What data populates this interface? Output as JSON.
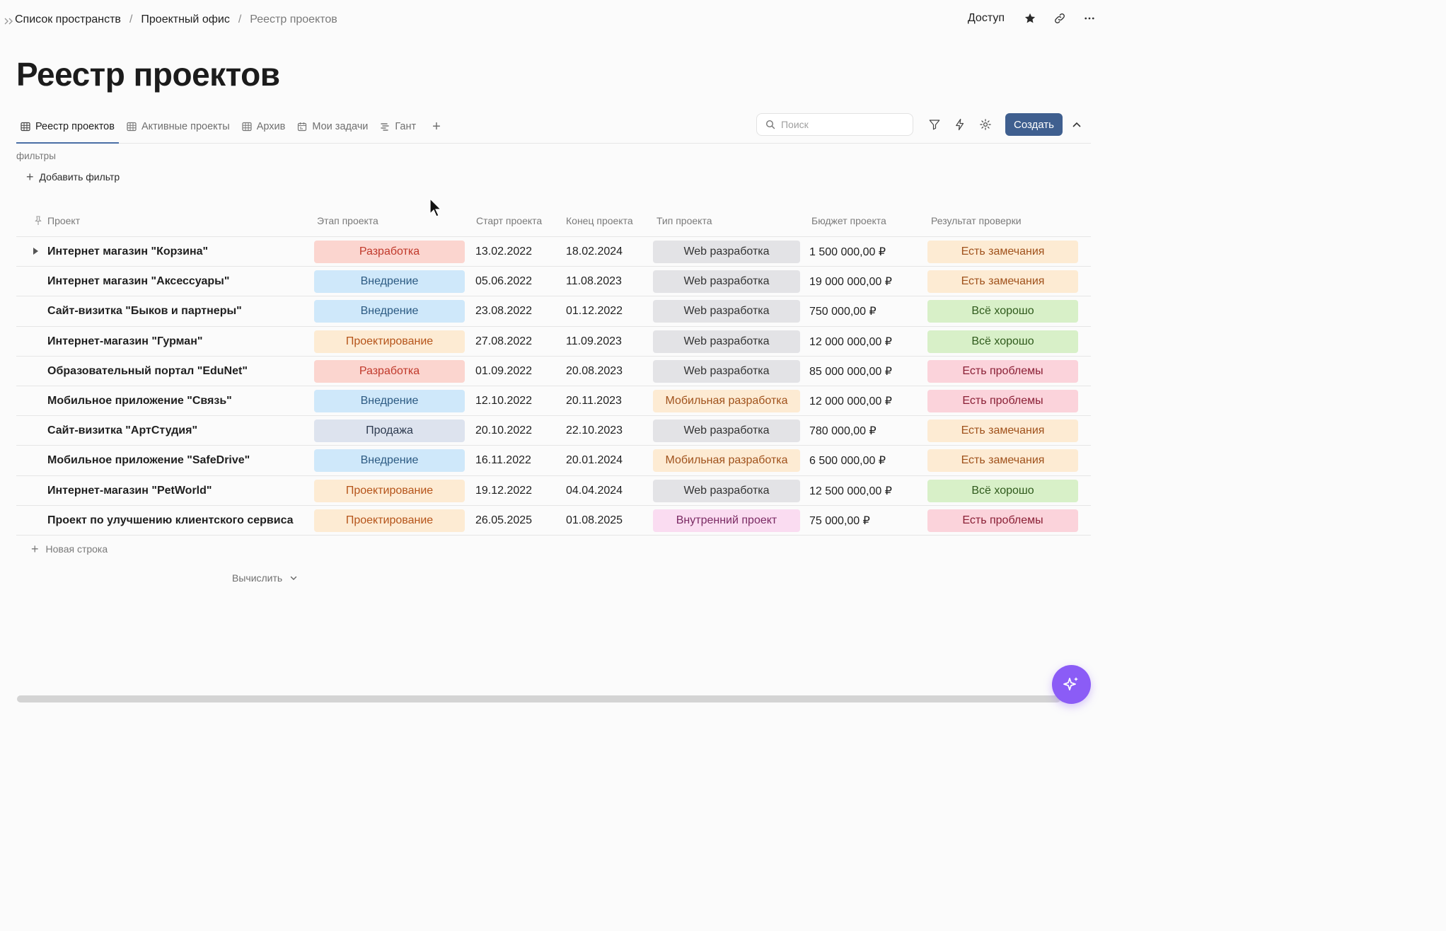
{
  "breadcrumb": {
    "items": [
      "Список пространств",
      "Проектный офис"
    ],
    "current": "Реестр проектов"
  },
  "header": {
    "access_label": "Доступ"
  },
  "page": {
    "title": "Реестр проектов"
  },
  "tabs": [
    {
      "label": "Реестр проектов",
      "icon": "table-icon",
      "active": true
    },
    {
      "label": "Активные проекты",
      "icon": "table-icon",
      "active": false
    },
    {
      "label": "Архив",
      "icon": "table-icon",
      "active": false
    },
    {
      "label": "Мои задачи",
      "icon": "calendar-icon",
      "active": false
    },
    {
      "label": "Гант",
      "icon": "gantt-icon",
      "active": false
    }
  ],
  "toolbar": {
    "search_placeholder": "Поиск",
    "create_label": "Создать"
  },
  "filters": {
    "label": "фильтры",
    "add_label": "Добавить фильтр"
  },
  "table": {
    "columns": [
      "Проект",
      "Этап проекта",
      "Старт проекта",
      "Конец проекта",
      "Тип проекта",
      "Бюджет проекта",
      "Результат проверки"
    ],
    "rows": [
      {
        "project": "Интернет магазин \"Корзина\"",
        "stage": "Разработка",
        "start": "13.02.2022",
        "end": "18.02.2024",
        "type": "Web разработка",
        "budget": "1 500 000,00 ₽",
        "result": "Есть замечания",
        "expandable": true
      },
      {
        "project": "Интернет магазин \"Аксессуары\"",
        "stage": "Внедрение",
        "start": "05.06.2022",
        "end": "11.08.2023",
        "type": "Web разработка",
        "budget": "19 000 000,00 ₽",
        "result": "Есть замечания"
      },
      {
        "project": "Сайт-визитка \"Быков и партнеры\"",
        "stage": "Внедрение",
        "start": "23.08.2022",
        "end": "01.12.2022",
        "type": "Web разработка",
        "budget": "750 000,00 ₽",
        "result": "Всё хорошо"
      },
      {
        "project": "Интернет-магазин \"Гурман\"",
        "stage": "Проектирование",
        "start": "27.08.2022",
        "end": "11.09.2023",
        "type": "Web разработка",
        "budget": "12 000 000,00 ₽",
        "result": "Всё хорошо"
      },
      {
        "project": "Образовательный портал \"EduNet\"",
        "stage": "Разработка",
        "start": "01.09.2022",
        "end": "20.08.2023",
        "type": "Web разработка",
        "budget": "85 000 000,00 ₽",
        "result": "Есть проблемы"
      },
      {
        "project": "Мобильное приложение \"Связь\"",
        "stage": "Внедрение",
        "start": "12.10.2022",
        "end": "20.11.2023",
        "type": "Мобильная разработка",
        "budget": "12 000 000,00 ₽",
        "result": "Есть проблемы"
      },
      {
        "project": "Сайт-визитка \"АртСтудия\"",
        "stage": "Продажа",
        "start": "20.10.2022",
        "end": "22.10.2023",
        "type": "Web разработка",
        "budget": "780 000,00 ₽",
        "result": "Есть замечания"
      },
      {
        "project": "Мобильное приложение \"SafeDrive\"",
        "stage": "Внедрение",
        "start": "16.11.2022",
        "end": "20.01.2024",
        "type": "Мобильная разработка",
        "budget": "6 500 000,00 ₽",
        "result": "Есть замечания"
      },
      {
        "project": "Интернет-магазин \"PetWorld\"",
        "stage": "Проектирование",
        "start": "19.12.2022",
        "end": "04.04.2024",
        "type": "Web разработка",
        "budget": "12 500 000,00 ₽",
        "result": "Всё хорошо"
      },
      {
        "project": "Проект по улучшению клиентского сервиса",
        "stage": "Проектирование",
        "start": "26.05.2025",
        "end": "01.08.2025",
        "type": "Внутренний проект",
        "budget": "75 000,00 ₽",
        "result": "Есть проблемы"
      }
    ],
    "new_row_label": "Новая строка",
    "calc_label": "Вычислить"
  },
  "colors": {
    "accent": "#3f5f8f",
    "ai_button": "#8b5cf6",
    "stage": {
      "Разработка": {
        "bg": "#fbd5cf",
        "fg": "#c0392b"
      },
      "Внедрение": {
        "bg": "#cfe8fa",
        "fg": "#2c5a82"
      },
      "Проектирование": {
        "bg": "#fdebd3",
        "fg": "#b5541a"
      },
      "Продажа": {
        "bg": "#dde3ee",
        "fg": "#2d3a4f"
      }
    },
    "type": {
      "Web разработка": {
        "bg": "#e3e3e6",
        "fg": "#333333"
      },
      "Мобильная разработка": {
        "bg": "#fdebd3",
        "fg": "#a0521c"
      },
      "Внутренний проект": {
        "bg": "#fadcf1",
        "fg": "#7a2a63"
      }
    },
    "result": {
      "Есть замечания": {
        "bg": "#fdebd3",
        "fg": "#a0521c"
      },
      "Всё хорошо": {
        "bg": "#d8f0c8",
        "fg": "#2f5a1c"
      },
      "Есть проблемы": {
        "bg": "#fbd3db",
        "fg": "#8a1f35"
      }
    }
  }
}
